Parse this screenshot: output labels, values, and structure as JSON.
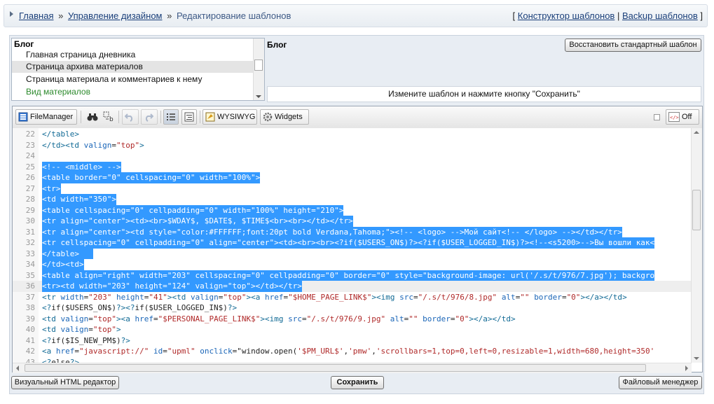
{
  "breadcrumb": {
    "home": "Главная",
    "sep": "»",
    "design": "Управление дизайном",
    "current": "Редактирование шаблонов"
  },
  "top_links": {
    "open": "[",
    "constructor": "Конструктор шаблонов",
    "divider": "|",
    "backup": "Backup шаблонов",
    "close": "]"
  },
  "template_list": {
    "group": "Блог",
    "items": [
      {
        "label": "Главная страница дневника"
      },
      {
        "label": "Страница архива материалов"
      },
      {
        "label": "Страница материала и комментариев к нему"
      },
      {
        "label": "Вид материалов"
      }
    ],
    "selected_index": 1
  },
  "panel": {
    "title": "Блог",
    "restore_button": "Восстановить стандартный шаблон",
    "hint": "Измените шаблон и нажмите кнопку \"Сохранить\""
  },
  "toolbar": {
    "file_manager": "FileManager",
    "wysiwyg": "WYSIWYG",
    "widgets": "Widgets",
    "off": "Off"
  },
  "code_lines": [
    {
      "n": "22",
      "text": "</table>"
    },
    {
      "n": "23",
      "text": "</td><td valign=\"top\">"
    },
    {
      "n": "24",
      "text": ""
    },
    {
      "n": "25",
      "text": "<!-- <middle> -->"
    },
    {
      "n": "26",
      "text": "<table border=\"0\" cellspacing=\"0\" width=\"100%\">"
    },
    {
      "n": "27",
      "text": "<tr>"
    },
    {
      "n": "28",
      "text": "<td width=\"350\">"
    },
    {
      "n": "29",
      "text": "<table cellspacing=\"0\" cellpadding=\"0\" width=\"100%\" height=\"210\">"
    },
    {
      "n": "30",
      "text": "<tr align=\"center\"><td><br>$WDAY$, $DATE$, $TIME$<br><br></td></tr>"
    },
    {
      "n": "31",
      "text": "<tr align=\"center\"><td style=\"color:#FFFFFF;font:20pt bold Verdana,Tahoma;\"><!-- <logo> -->Мой сайт<!-- </logo> --></td></tr>"
    },
    {
      "n": "32",
      "text": "<tr cellspacing=\"0\" cellpadding=\"0\" align=\"center\"><td><br><br><?if($USERS_ON$)?><?if($USER_LOGGED_IN$)?><!--<s5200>-->Вы вошли как<"
    },
    {
      "n": "33",
      "text": "</table>   "
    },
    {
      "n": "34",
      "text": "</td><td>"
    },
    {
      "n": "35",
      "text": "<table align=\"right\" width=\"203\" cellspacing=\"0\" cellpadding=\"0\" border=\"0\" style=\"background-image: url('/.s/t/976/7.jpg'); backgro"
    },
    {
      "n": "36",
      "text": "<tr><td width=\"203\" height=\"124\" valign=\"top\"></td></tr>"
    },
    {
      "n": "37",
      "text": "<tr width=\"203\" height=\"41\"><td valign=\"top\"><a href=\"$HOME_PAGE_LINK$\"><img src=\"/.s/t/976/8.jpg\" alt=\"\" border=\"0\"></a></td>"
    },
    {
      "n": "38",
      "text": "<?if($USERS_ON$)?><?if($USER_LOGGED_IN$)?>"
    },
    {
      "n": "39",
      "text": "<td valign=\"top\"><a href=\"$PERSONAL_PAGE_LINK$\"><img src=\"/.s/t/976/9.jpg\" alt=\"\" border=\"0\"></a></td>"
    },
    {
      "n": "40",
      "text": "<td valign=\"top\">"
    },
    {
      "n": "41",
      "text": "<?if($IS_NEW_PM$)?>"
    },
    {
      "n": "42",
      "text": "<a href=\"javascript://\" id=\"upml\" onclick=\"window.open('$PM_URL$','pmw','scrollbars=1,top=0,left=0,resizable=1,width=680,height=350'"
    },
    {
      "n": "43",
      "text": "<?else?>"
    }
  ],
  "selection": {
    "from": 25,
    "to": 36
  },
  "current_line": 36,
  "bottom": {
    "visual_editor": "Визуальный HTML редактор",
    "save": "Сохранить",
    "file_manager": "Файловый менеджер"
  },
  "colors": {
    "tag": "#116a95",
    "attr": "#1b66b8",
    "string": "#b02a2a",
    "selection": "#3399ff",
    "link": "#1a3f7a"
  }
}
